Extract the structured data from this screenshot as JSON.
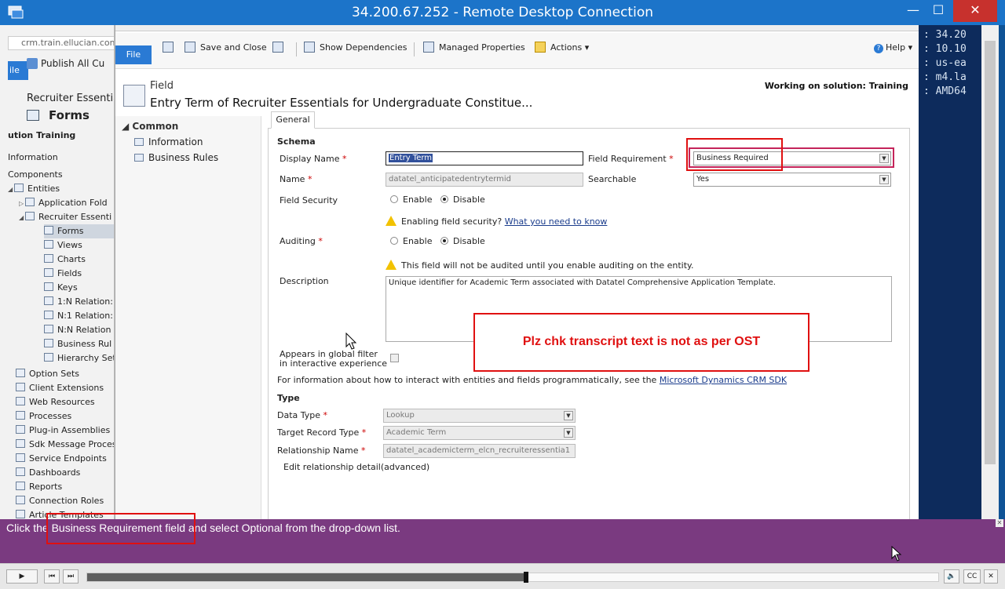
{
  "rdp": {
    "title": "34.200.67.252 - Remote Desktop Connection",
    "minimize": "—",
    "maximize": "☐",
    "close": "✕"
  },
  "left_window": {
    "address": "crm.train.ellucian.com/R",
    "file_label": "ile",
    "publish_label": "Publish All Cu",
    "recruiter_label": "Recruiter Essential",
    "forms_title": "Forms",
    "solution_label": "ution Training",
    "tree": [
      {
        "label": "Information"
      },
      {
        "label": "Components"
      },
      {
        "label": "Entities"
      },
      {
        "label": "Application Fold"
      },
      {
        "label": "Recruiter Essenti"
      },
      {
        "label": "Forms"
      },
      {
        "label": "Views"
      },
      {
        "label": "Charts"
      },
      {
        "label": "Fields"
      },
      {
        "label": "Keys"
      },
      {
        "label": "1:N Relation:"
      },
      {
        "label": "N:1 Relation:"
      },
      {
        "label": "N:N Relation"
      },
      {
        "label": "Business Rul"
      },
      {
        "label": "Hierarchy Set"
      },
      {
        "label": "Option Sets"
      },
      {
        "label": "Client Extensions"
      },
      {
        "label": "Web Resources"
      },
      {
        "label": "Processes"
      },
      {
        "label": "Plug-in Assemblies"
      },
      {
        "label": "Sdk Message Proces"
      },
      {
        "label": "Service Endpoints"
      },
      {
        "label": "Dashboards"
      },
      {
        "label": "Reports"
      },
      {
        "label": "Connection Roles"
      },
      {
        "label": "Article Templates"
      }
    ]
  },
  "ribbon": {
    "file": "File",
    "save_close": "Save and Close",
    "show_dependencies": "Show Dependencies",
    "managed_properties": "Managed Properties",
    "actions": "Actions",
    "help": "Help"
  },
  "header": {
    "entity_type": "Field",
    "entity_name": "Entry Term of Recruiter Essentials for Undergraduate Constitue...",
    "solution_note": "Working on solution: Training"
  },
  "leftnav": {
    "common": "Common",
    "items": [
      {
        "label": "Information"
      },
      {
        "label": "Business Rules"
      }
    ]
  },
  "form": {
    "tab": "General",
    "schema_title": "Schema",
    "display_name_label": "Display Name",
    "display_name_value": "Entry Term",
    "field_requirement_label": "Field Requirement",
    "field_requirement_value": "Business Required",
    "name_label": "Name",
    "name_value": "datatel_anticipatedentrytermid",
    "searchable_label": "Searchable",
    "searchable_value": "Yes",
    "field_security_label": "Field Security",
    "enable": "Enable",
    "disable": "Disable",
    "security_warning": "Enabling field security?",
    "security_link": "What you need to know",
    "auditing_label": "Auditing",
    "auditing_warning": "This field will not be audited until you enable auditing on the entity.",
    "description_label": "Description",
    "description_value": "Unique identifier for Academic Term associated with Datatel Comprehensive Application Template.",
    "global_filter_label_1": "Appears in global filter",
    "global_filter_label_2": "in interactive experience",
    "sdk_info": "For information about how to interact with entities and fields programmatically, see the",
    "sdk_link": "Microsoft Dynamics CRM SDK",
    "type_title": "Type",
    "data_type_label": "Data Type",
    "data_type_value": "Lookup",
    "target_record_label": "Target Record Type",
    "target_record_value": "Academic Term",
    "relationship_label": "Relationship Name",
    "relationship_value": "datatel_academicterm_elcn_recruiteressentia1",
    "edit_relationship": "Edit relationship detail(advanced)",
    "required_marker": "*"
  },
  "review_note": "Plz chk transcript text is not as per OST",
  "terminal": {
    "lines": [
      ": 34.20",
      ": 10.10",
      ": us-ea",
      ": m4.la",
      ": AMD64"
    ]
  },
  "caption": "Click the Business Requirement field and select Optional from the drop-down list.",
  "player": {
    "play": "▶",
    "prev": "⏮",
    "next": "⏭",
    "volume": "🔈",
    "cc": "CC",
    "close": "✕",
    "progress": 0.515
  }
}
